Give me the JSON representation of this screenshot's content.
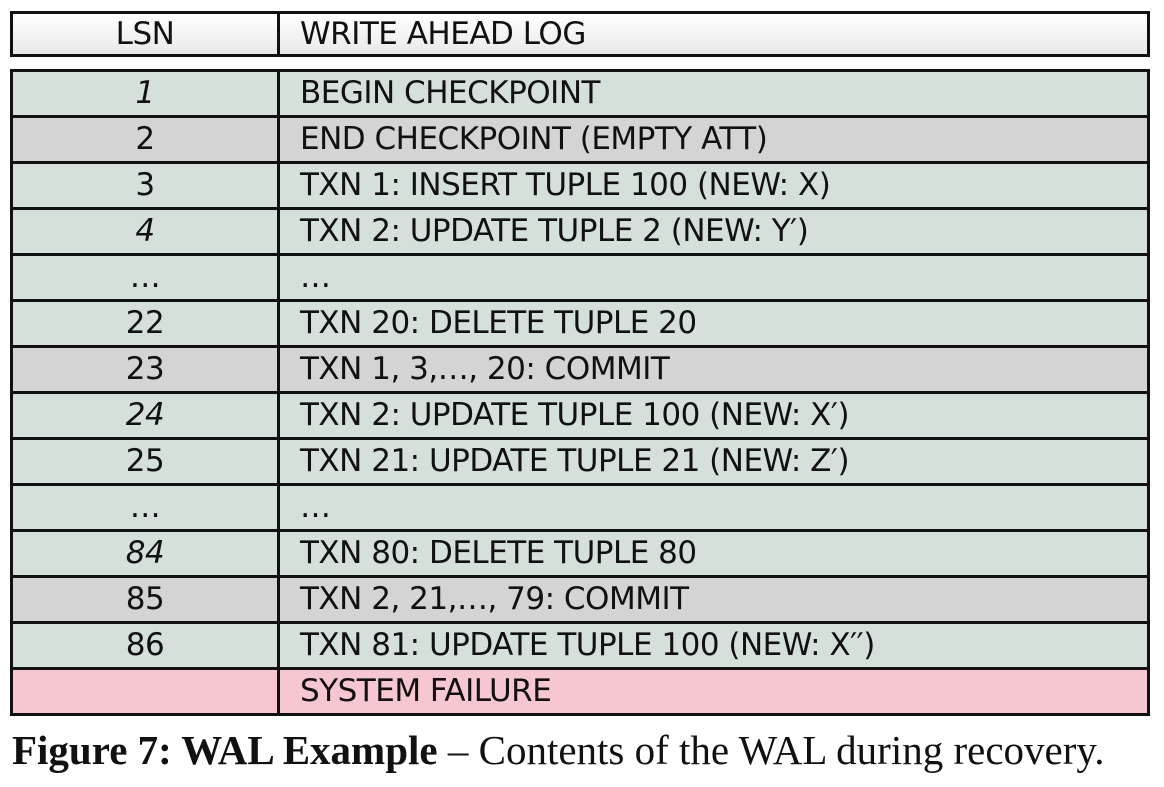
{
  "header": {
    "lsn": "LSN",
    "log": "WRITE AHEAD LOG"
  },
  "rows": [
    {
      "lsn": "1",
      "entry": "BEGIN CHECKPOINT",
      "color": "#d5e0db"
    },
    {
      "lsn": "2",
      "entry": "END CHECKPOINT (EMPTY ATT)",
      "color": "#d4d4d4"
    },
    {
      "lsn": "3",
      "entry": "TXN 1: INSERT TUPLE 100 (NEW: X)",
      "color": "#d5e0db"
    },
    {
      "lsn": "4",
      "entry": "TXN 2: UPDATE TUPLE 2 (NEW: Y′)",
      "color": "#d5e0db"
    },
    {
      "lsn": "…",
      "entry": "…",
      "color": "#d5e0db"
    },
    {
      "lsn": "22",
      "entry": "TXN 20: DELETE TUPLE 20",
      "color": "#d5e0db"
    },
    {
      "lsn": "23",
      "entry": "TXN 1, 3,…, 20: COMMIT",
      "color": "#d4d4d4"
    },
    {
      "lsn": "24",
      "entry": "TXN 2: UPDATE TUPLE 100 (NEW: X′)",
      "color": "#d5e0db"
    },
    {
      "lsn": "25",
      "entry": "TXN 21: UPDATE TUPLE 21 (NEW: Z′)",
      "color": "#d5e0db"
    },
    {
      "lsn": "…",
      "entry": "…",
      "color": "#d5e0db"
    },
    {
      "lsn": "84",
      "entry": "TXN 80: DELETE TUPLE 80",
      "color": "#d5e0db"
    },
    {
      "lsn": "85",
      "entry": "TXN 2, 21,…, 79: COMMIT",
      "color": "#d4d4d4"
    },
    {
      "lsn": "86",
      "entry": "TXN 81: UPDATE TUPLE 100 (NEW: X′′)",
      "color": "#d5e0db"
    },
    {
      "lsn": "",
      "entry": "SYSTEM FAILURE",
      "color": "#f6c7d0"
    }
  ],
  "caption": {
    "label": "Figure 7: WAL Example",
    "text": " – Contents of the WAL during recovery."
  }
}
